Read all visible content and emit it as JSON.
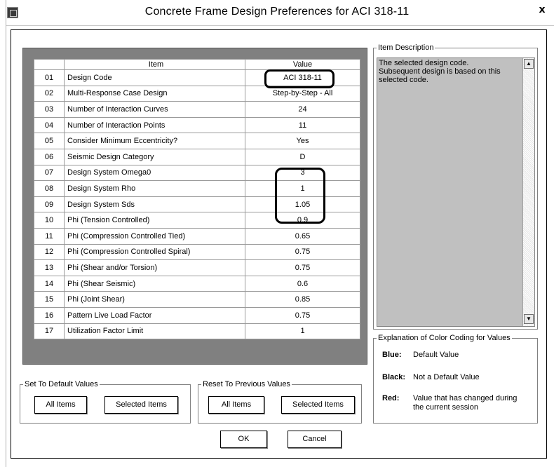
{
  "window": {
    "title": "Concrete Frame Design Preferences for ACI 318-11",
    "close_label": "x"
  },
  "table": {
    "headers": {
      "item": "Item",
      "value": "Value"
    },
    "rows": [
      {
        "num": "01",
        "item": "Design Code",
        "value": "ACI 318-11"
      },
      {
        "num": "02",
        "item": "Multi-Response Case Design",
        "value": "Step-by-Step - All"
      },
      {
        "num": "03",
        "item": "Number of Interaction Curves",
        "value": "24"
      },
      {
        "num": "04",
        "item": "Number of Interaction Points",
        "value": "11"
      },
      {
        "num": "05",
        "item": "Consider Minimum Eccentricity?",
        "value": "Yes"
      },
      {
        "num": "06",
        "item": "Seismic Design Category",
        "value": "D"
      },
      {
        "num": "07",
        "item": "Design System Omega0",
        "value": "3"
      },
      {
        "num": "08",
        "item": "Design System Rho",
        "value": "1"
      },
      {
        "num": "09",
        "item": "Design System Sds",
        "value": "1.05"
      },
      {
        "num": "10",
        "item": "Phi (Tension Controlled)",
        "value": "0.9"
      },
      {
        "num": "11",
        "item": "Phi (Compression Controlled Tied)",
        "value": "0.65"
      },
      {
        "num": "12",
        "item": "Phi (Compression Controlled Spiral)",
        "value": "0.75"
      },
      {
        "num": "13",
        "item": "Phi (Shear and/or Torsion)",
        "value": "0.75"
      },
      {
        "num": "14",
        "item": "Phi (Shear Seismic)",
        "value": "0.6"
      },
      {
        "num": "15",
        "item": "Phi (Joint Shear)",
        "value": "0.85"
      },
      {
        "num": "16",
        "item": "Pattern Live Load Factor",
        "value": "0.75"
      },
      {
        "num": "17",
        "item": "Utilization Factor Limit",
        "value": "1"
      }
    ]
  },
  "item_description": {
    "legend": "Item Description",
    "text": "The selected design code.\nSubsequent design is based on this\nselected code."
  },
  "color_coding": {
    "legend": "Explanation of Color Coding for Values",
    "entries": [
      {
        "key": "Blue:",
        "desc": "Default Value",
        "color": "#000000"
      },
      {
        "key": "Black:",
        "desc": "Not a Default Value",
        "color": "#000000"
      },
      {
        "key": "Red:",
        "desc": "Value that has changed during the current session",
        "color": "#000000"
      }
    ]
  },
  "set_default": {
    "legend": "Set To Default Values",
    "all_label": "All Items",
    "selected_label": "Selected Items"
  },
  "reset_previous": {
    "legend": "Reset To Previous Values",
    "all_label": "All Items",
    "selected_label": "Selected Items"
  },
  "buttons": {
    "ok": "OK",
    "cancel": "Cancel"
  }
}
